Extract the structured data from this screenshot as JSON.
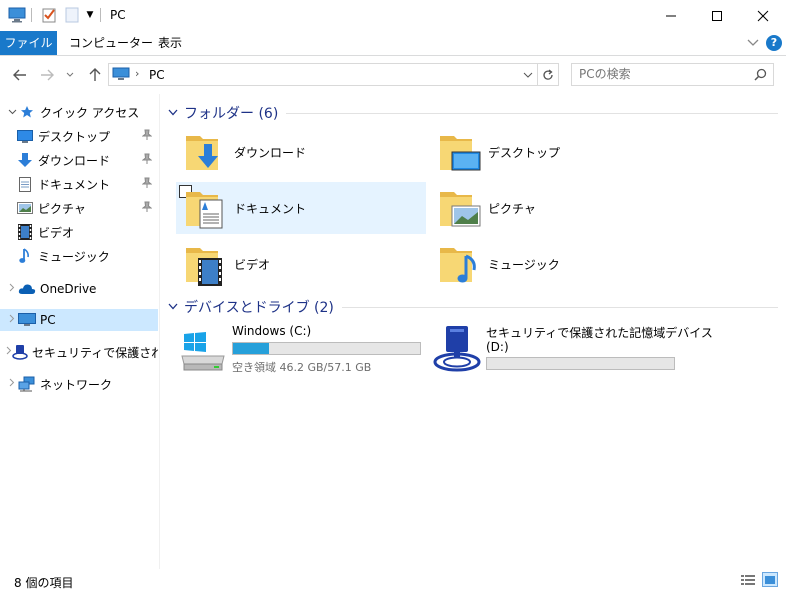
{
  "window": {
    "title": "PC"
  },
  "ribbon": {
    "tabs": [
      "ファイル",
      "コンピューター",
      "表示"
    ]
  },
  "address": {
    "path": "PC",
    "search_placeholder": "PCの検索"
  },
  "nav": {
    "quick_access": "クイック アクセス",
    "pinned": [
      "デスクトップ",
      "ダウンロード",
      "ドキュメント",
      "ピクチャ"
    ],
    "others": [
      "ビデオ",
      "ミュージック"
    ],
    "onedrive": "OneDrive",
    "pc": "PC",
    "secure": "セキュリティで保護された",
    "network": "ネットワーク"
  },
  "folders": {
    "header": "フォルダー (6)",
    "items": [
      "ダウンロード",
      "デスクトップ",
      "ドキュメント",
      "ピクチャ",
      "ビデオ",
      "ミュージック"
    ]
  },
  "drives": {
    "header": "デバイスとドライブ (2)",
    "c": {
      "name": "Windows (C:)",
      "free_text": "空き領域 46.2 GB/57.1 GB",
      "used_fraction": 0.19
    },
    "d": {
      "name_line1": "セキュリティで保護された記憶域デバイス",
      "name_line2": "(D:)"
    }
  },
  "status": {
    "count": "8 個の項目"
  },
  "colors": {
    "accent": "#1979ca",
    "header": "#1e3287",
    "folder": "#f7d774",
    "selected": "#cce8ff",
    "hover": "#e5f3ff",
    "drive_fill": "#26a0da"
  }
}
